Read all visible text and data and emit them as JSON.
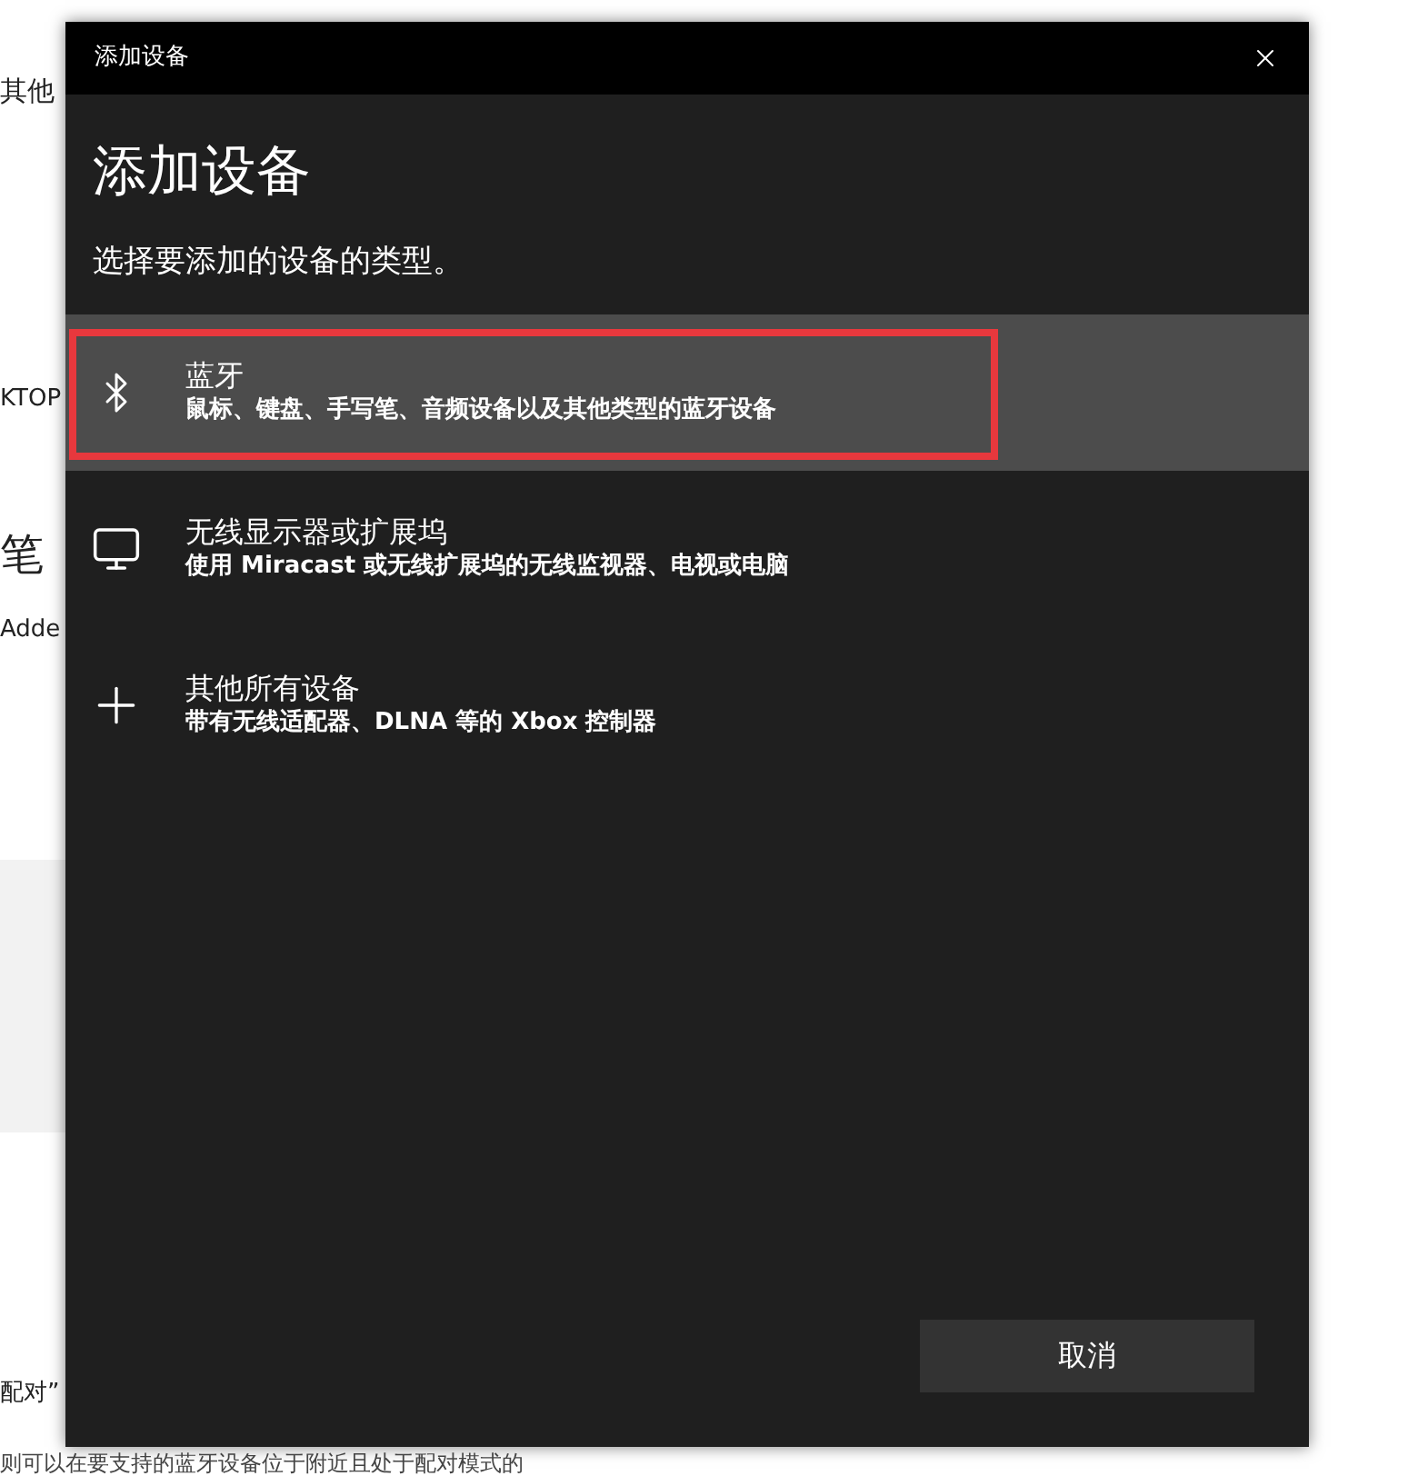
{
  "background_page": {
    "texts": [
      "其他",
      "KTOP",
      "笔",
      "Adde",
      "配对”"
    ],
    "bottom_line": "则可以在要支持的蓝牙设备位于附近且处于配对模式的"
  },
  "window": {
    "title": "添加设备",
    "heading": "添加设备",
    "subtitle": "选择要添加的设备的类型。"
  },
  "device_types": [
    {
      "kind": "bluetooth",
      "name": "蓝牙",
      "description": "鼠标、键盘、手写笔、音频设备以及其他类型的蓝牙设备",
      "selected": true,
      "marked": true
    },
    {
      "kind": "display",
      "name": "无线显示器或扩展坞",
      "description": "使用 Miracast 或无线扩展坞的无线监视器、电视或电脑",
      "selected": false,
      "marked": false
    },
    {
      "kind": "other",
      "name": "其他所有设备",
      "description": "带有无线适配器、DLNA 等的 Xbox 控制器",
      "selected": false,
      "marked": false
    }
  ],
  "buttons": [
    "取消"
  ]
}
